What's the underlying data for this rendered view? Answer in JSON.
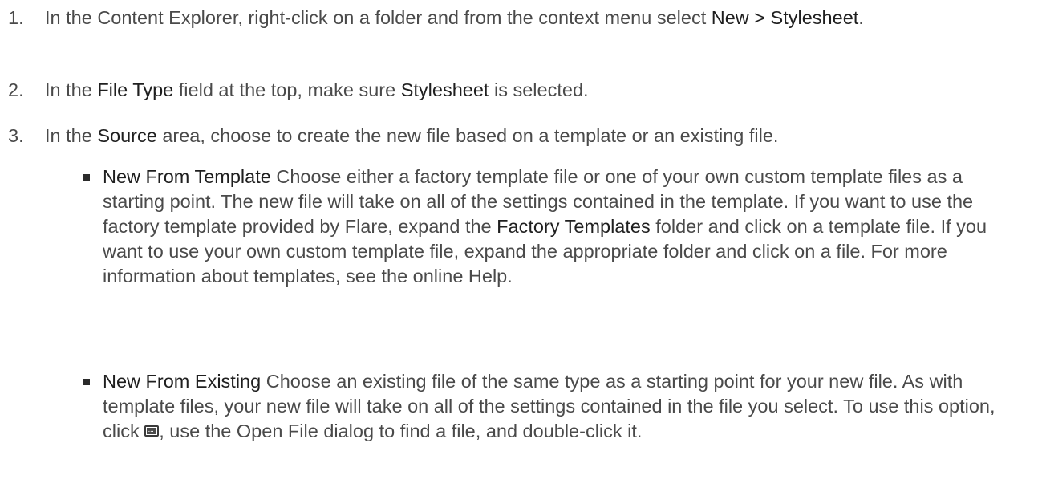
{
  "steps": [
    {
      "number": "1.",
      "parts": {
        "a": "In the Content Explorer, right-click on a folder and from the context menu select ",
        "b": "New > Stylesheet",
        "c": "."
      }
    },
    {
      "number": "2.",
      "parts": {
        "a": "In the ",
        "b": "File Type",
        "c": " field at the top, make sure ",
        "d": "Stylesheet",
        "e": " is selected."
      }
    },
    {
      "number": "3.",
      "parts": {
        "a": "In the ",
        "b": "Source",
        "c": " area, choose to create the new file based on a template or an existing file."
      }
    }
  ],
  "options": [
    {
      "title": "New From Template",
      "text1": " Choose either a factory template file or one of your own custom template files as a starting point. The new file will take on all of the settings contained in the template. If you want to use the factory template provided by Flare, expand the ",
      "bold2": "Factory Templates",
      "text2": " folder and click on a template file. If you want to use your own custom template file, expand the appropriate folder and click on a file. For more information about templates, see the online Help."
    },
    {
      "title": "New From Existing",
      "text1": " Choose an existing file of the same type as a starting point for your new file. As with template files, your new file will take on all of the settings contained in the file you select. To use this option, click ",
      "icon": "browse-ellipsis-icon",
      "text2": ", use the Open File dialog to find a file, and double-click it."
    }
  ]
}
